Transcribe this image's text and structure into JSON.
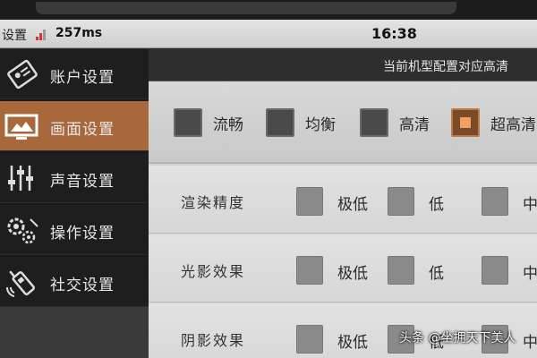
{
  "status_bar": {
    "settings_label": "设置",
    "ping": "257ms",
    "clock": "16:38",
    "signal_color": "#dd3333"
  },
  "sidebar": {
    "items": [
      {
        "label": "账户设置",
        "icon": "account-card-icon",
        "active": false
      },
      {
        "label": "画面设置",
        "icon": "display-screen-icon",
        "active": true
      },
      {
        "label": "声音设置",
        "icon": "audio-sliders-icon",
        "active": false
      },
      {
        "label": "操作设置",
        "icon": "gear-controls-icon",
        "active": false
      },
      {
        "label": "社交设置",
        "icon": "walkie-talkie-icon",
        "active": false
      }
    ]
  },
  "notice": "当前机型配置对应高清",
  "presets": [
    {
      "label": "流畅",
      "selected": false
    },
    {
      "label": "均衡",
      "selected": false
    },
    {
      "label": "高清",
      "selected": false
    },
    {
      "label": "超高清",
      "selected": true
    }
  ],
  "settings": [
    {
      "label": "渲染精度",
      "options": [
        "极低",
        "低",
        "中"
      ]
    },
    {
      "label": "光影效果",
      "options": [
        "极低",
        "低",
        "中"
      ]
    },
    {
      "label": "阴影效果",
      "options": [
        "极低",
        "低",
        "中"
      ]
    }
  ],
  "watermark": "头条 @坐拥天下美人",
  "colors": {
    "active_tab": "#a8683c",
    "selected_checkbox": "#f0a060"
  }
}
